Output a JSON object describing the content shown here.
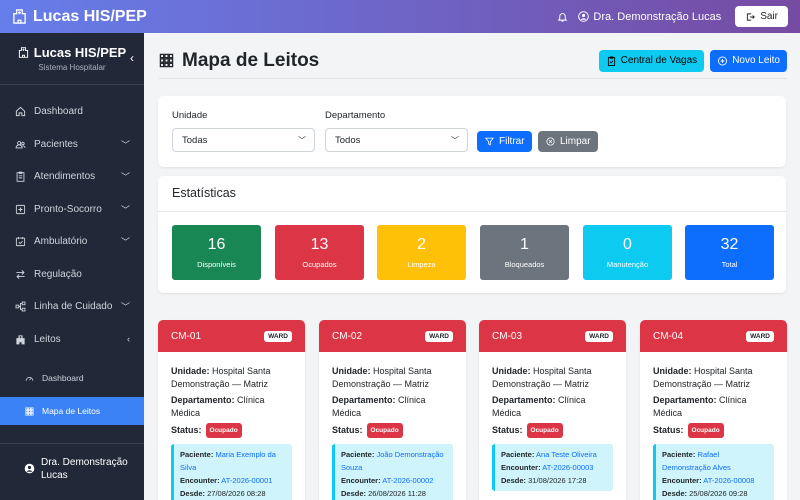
{
  "topbar": {
    "brand": "Lucas HIS/PEP",
    "user": "Dra. Demonstração Lucas",
    "logout": "Sair"
  },
  "sidebar": {
    "title": "Lucas HIS/PEP",
    "subtitle": "Sistema Hospitalar",
    "items": [
      {
        "label": "Dashboard",
        "icon": "home-icon",
        "chevron": ""
      },
      {
        "label": "Pacientes",
        "icon": "people-icon",
        "chevron": "down"
      },
      {
        "label": "Atendimentos",
        "icon": "clipboard-icon",
        "chevron": "down"
      },
      {
        "label": "Pronto-Socorro",
        "icon": "medical-plus-icon",
        "chevron": "down"
      },
      {
        "label": "Ambulatório",
        "icon": "calendar-check-icon",
        "chevron": "down"
      },
      {
        "label": "Regulação",
        "icon": "arrows-icon",
        "chevron": ""
      },
      {
        "label": "Linha de Cuidado",
        "icon": "diagram-icon",
        "chevron": "down"
      },
      {
        "label": "Leitos",
        "icon": "hospital-icon",
        "chevron": "left"
      }
    ],
    "subitems": [
      {
        "label": "Dashboard",
        "icon": "speedometer-icon"
      },
      {
        "label": "Mapa de Leitos",
        "icon": "grid-icon"
      }
    ],
    "user": "Dra. Demonstração Lucas"
  },
  "page": {
    "title": "Mapa de Leitos",
    "btn_vagas": "Central de Vagas",
    "btn_novo": "Novo Leito"
  },
  "filters": {
    "unidade_label": "Unidade",
    "unidade_value": "Todas",
    "departamento_label": "Departamento",
    "departamento_value": "Todos",
    "filtrar": "Filtrar",
    "limpar": "Limpar"
  },
  "stats": {
    "title": "Estatísticas",
    "items": [
      {
        "value": "16",
        "label": "Disponíveis",
        "color": "#198754"
      },
      {
        "value": "13",
        "label": "Ocupados",
        "color": "#dc3545"
      },
      {
        "value": "2",
        "label": "Limpeza",
        "color": "#ffc107"
      },
      {
        "value": "1",
        "label": "Bloqueados",
        "color": "#6c757d"
      },
      {
        "value": "0",
        "label": "Manutenção",
        "color": "#0dcaf0"
      },
      {
        "value": "32",
        "label": "Total",
        "color": "#0d6efd"
      }
    ]
  },
  "beds": [
    {
      "code": "CM-01",
      "type": "WARD",
      "unidade_label": "Unidade:",
      "unidade": "Hospital Santa Demonstração — Matriz",
      "dep_label": "Departamento:",
      "dep": "Clínica Médica",
      "status_label": "Status:",
      "status": "Ocupado",
      "pac_label": "Paciente:",
      "paciente": "Maria Exemplo da Silva",
      "enc_label": "Encounter:",
      "encounter": "AT-2026-00001",
      "desde_label": "Desde:",
      "desde": "27/08/2026 08:28"
    },
    {
      "code": "CM-02",
      "type": "WARD",
      "unidade_label": "Unidade:",
      "unidade": "Hospital Santa Demonstração — Matriz",
      "dep_label": "Departamento:",
      "dep": "Clínica Médica",
      "status_label": "Status:",
      "status": "Ocupado",
      "pac_label": "Paciente:",
      "paciente": "João Demonstração Souza",
      "enc_label": "Encounter:",
      "encounter": "AT-2026-00002",
      "desde_label": "Desde:",
      "desde": "26/08/2026 11:28"
    },
    {
      "code": "CM-03",
      "type": "WARD",
      "unidade_label": "Unidade:",
      "unidade": "Hospital Santa Demonstração — Matriz",
      "dep_label": "Departamento:",
      "dep": "Clínica Médica",
      "status_label": "Status:",
      "status": "Ocupado",
      "pac_label": "Paciente:",
      "paciente": "Ana Teste Oliveira",
      "enc_label": "Encounter:",
      "encounter": "AT-2026-00003",
      "desde_label": "Desde:",
      "desde": "31/08/2026 17:28"
    },
    {
      "code": "CM-04",
      "type": "WARD",
      "unidade_label": "Unidade:",
      "unidade": "Hospital Santa Demonstração — Matriz",
      "dep_label": "Departamento:",
      "dep": "Clínica Médica",
      "status_label": "Status:",
      "status": "Ocupado",
      "pac_label": "Paciente:",
      "paciente": "Rafael Demonstração Alves",
      "enc_label": "Encounter:",
      "encounter": "AT-2026-00008",
      "desde_label": "Desde:",
      "desde": "25/08/2026 09:28"
    }
  ]
}
